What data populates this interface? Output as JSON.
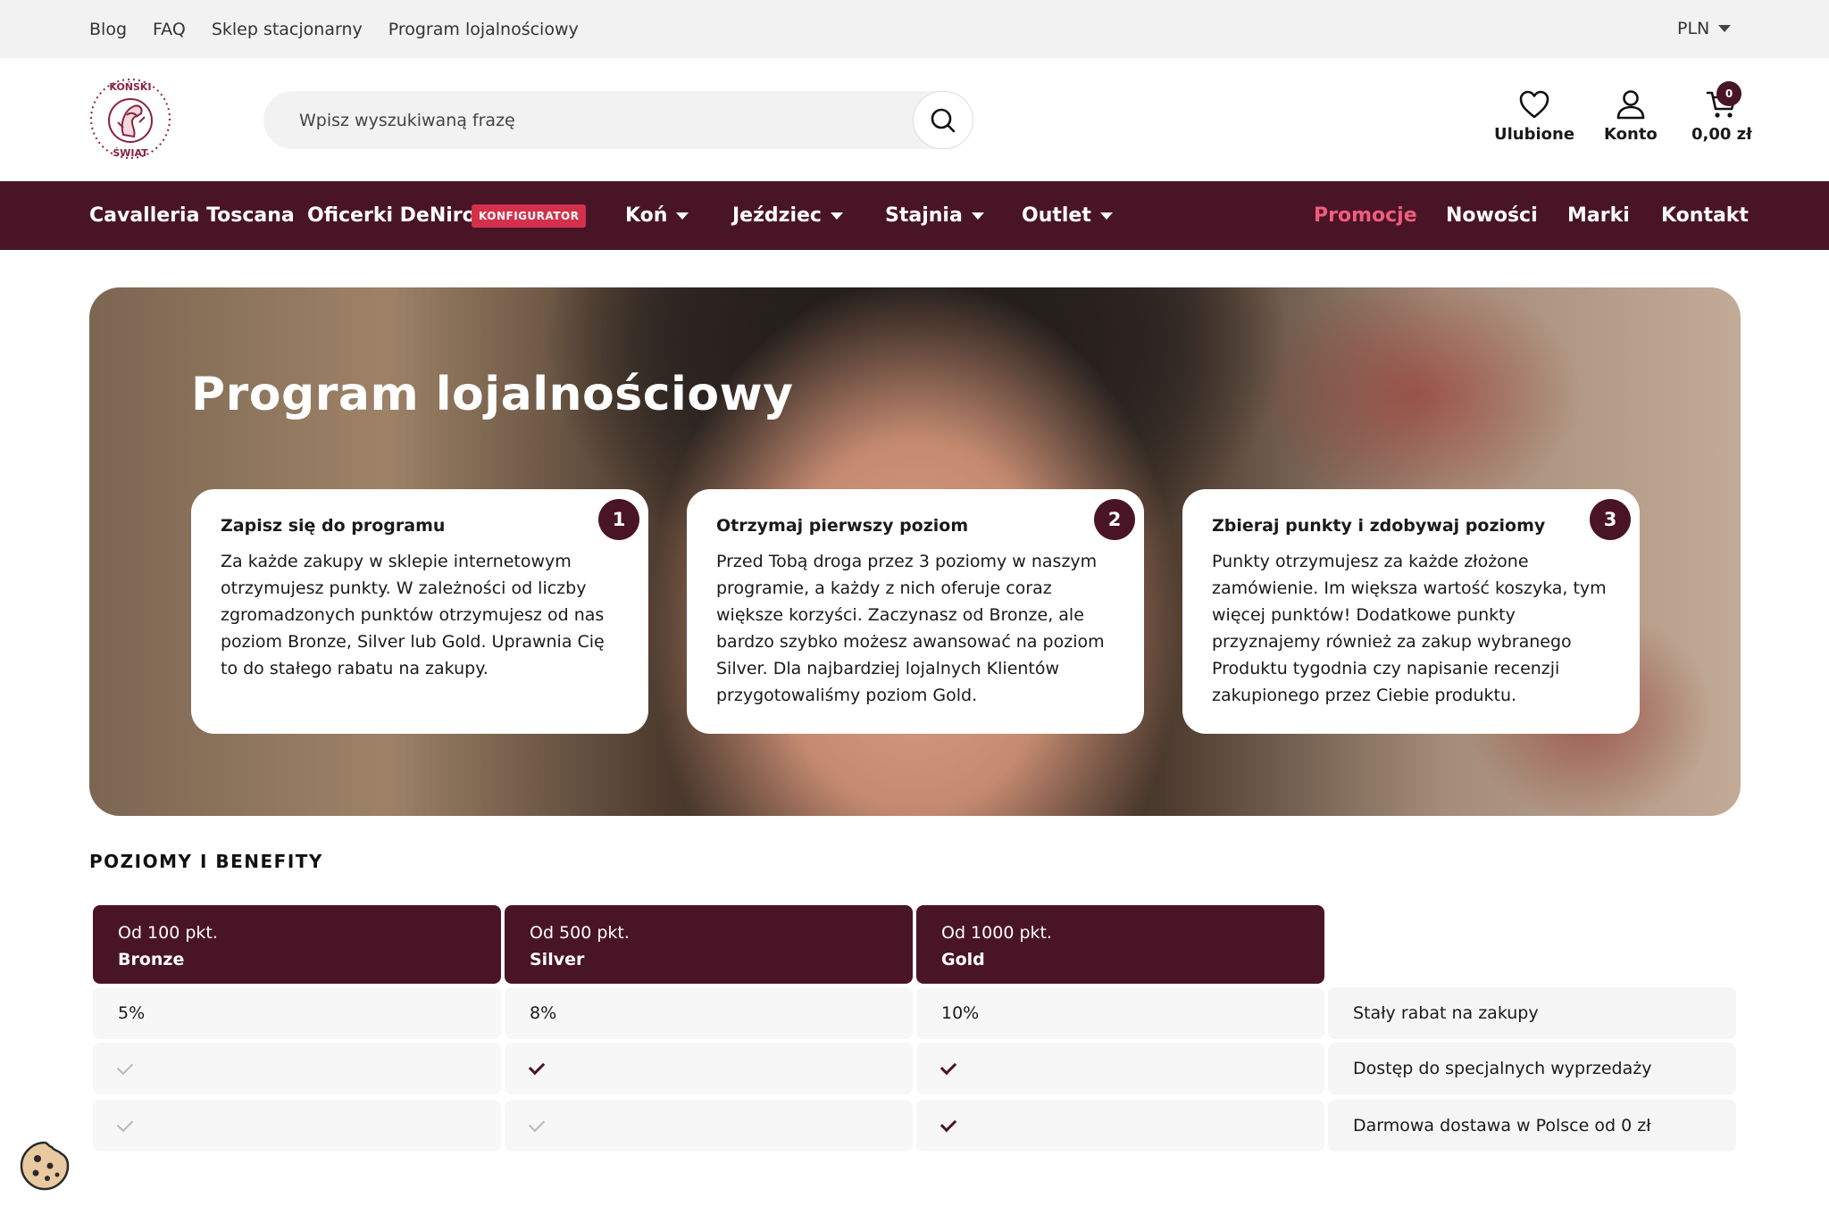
{
  "topbar": {
    "links": [
      "Blog",
      "FAQ",
      "Sklep stacjonarny",
      "Program lojalnościowy"
    ],
    "currency": "PLN"
  },
  "header": {
    "logo_alt": "KOŃSKI ŚWIAT",
    "search_placeholder": "Wpisz wyszukiwaną frazę",
    "favorites_label": "Ulubione",
    "account_label": "Konto",
    "cart_total": "0,00 zł",
    "cart_count": "0"
  },
  "nav": {
    "left": [
      {
        "label": "Cavalleria Toscana",
        "dropdown": false
      },
      {
        "label": "Oficerki DeNiro",
        "dropdown": false
      },
      {
        "label": "Koń",
        "dropdown": true
      },
      {
        "label": "Jeździec",
        "dropdown": true
      },
      {
        "label": "Stajnia",
        "dropdown": true
      },
      {
        "label": "Outlet",
        "dropdown": true
      }
    ],
    "badge": "KONFIGURATOR",
    "right": [
      "Promocje",
      "Nowości",
      "Marki",
      "Kontakt"
    ],
    "highlight_color": "#f05d7c"
  },
  "hero": {
    "title": "Program lojalnościowy",
    "steps": [
      {
        "num": "1",
        "title": "Zapisz się do programu",
        "text": "Za każde zakupy w sklepie internetowym otrzymujesz punkty. W zależności od liczby zgromadzonych punktów otrzymujesz od nas poziom Bronze, Silver lub Gold. Uprawnia Cię to do stałego rabatu na zakupy."
      },
      {
        "num": "2",
        "title": "Otrzymaj pierwszy poziom",
        "text": "Przed Tobą droga przez 3 poziomy w naszym programie, a każdy z nich oferuje coraz większe korzyści. Zaczynasz od Bronze, ale bardzo szybko możesz awansować na poziom Silver. Dla najbardziej lojalnych Klientów przygotowaliśmy poziom Gold."
      },
      {
        "num": "3",
        "title": "Zbieraj punkty i zdobywaj poziomy",
        "text": "Punkty otrzymujesz za każde złożone zamówienie. Im większa wartość koszyka, tym więcej punktów! Dodatkowe punkty przyznajemy również za zakup wybranego Produktu tygodnia czy napisanie recenzji zakupionego przez Ciebie produktu."
      }
    ]
  },
  "levels": {
    "heading": "POZIOMY I BENEFITY",
    "tiers": [
      {
        "threshold": "Od 100 pkt.",
        "name": "Bronze"
      },
      {
        "threshold": "Od 500 pkt.",
        "name": "Silver"
      },
      {
        "threshold": "Od 1000 pkt.",
        "name": "Gold"
      }
    ],
    "rows": [
      {
        "values": [
          "5%",
          "8%",
          "10%"
        ],
        "label": "Stały rabat na zakupy"
      },
      {
        "checks": [
          false,
          true,
          true
        ],
        "label": "Dostęp do specjalnych wyprzedaży"
      },
      {
        "checks": [
          false,
          false,
          true
        ],
        "label": "Darmowa dostawa w Polsce od 0 zł"
      }
    ]
  },
  "colors": {
    "brand": "#4a1427",
    "accent": "#d3314b"
  },
  "icons": [
    "search-icon",
    "heart-icon",
    "user-icon",
    "cart-icon",
    "chevron-down-icon",
    "check-icon",
    "cookie-icon"
  ]
}
